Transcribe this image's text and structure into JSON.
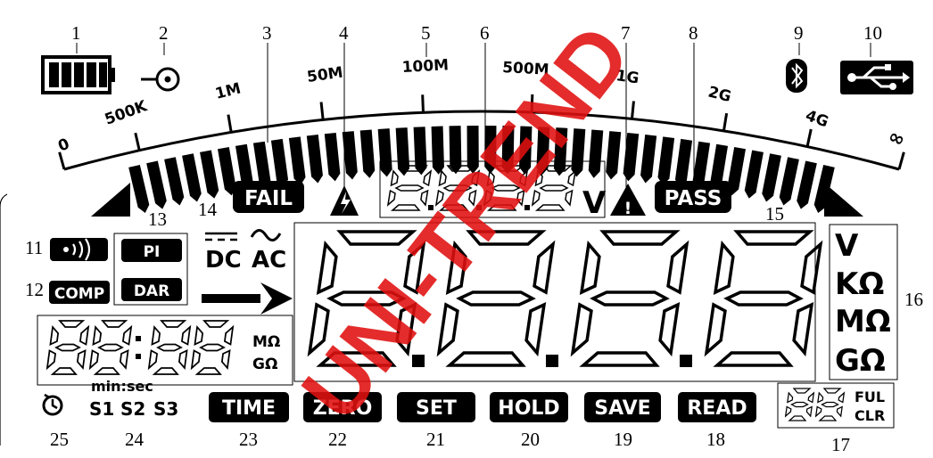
{
  "callouts": [
    "1",
    "2",
    "3",
    "4",
    "5",
    "6",
    "7",
    "8",
    "9",
    "10",
    "11",
    "12",
    "13",
    "14",
    "15",
    "16",
    "17",
    "18",
    "19",
    "20",
    "21",
    "22",
    "23",
    "24",
    "25"
  ],
  "scale": {
    "s0": "0",
    "s500k": "500K",
    "s1m": "1M",
    "s50m": "50M",
    "s100m": "100M",
    "s500m": "500M",
    "s1g": "1G",
    "s2g": "2G",
    "s4g": "4G",
    "sinf": "∞"
  },
  "indicators": {
    "fail": "FAIL",
    "pass": "PASS",
    "volt": "V",
    "pi": "PI",
    "dar": "DAR",
    "comp": "COMP",
    "dc": "DC",
    "ac": "AC",
    "dc_symbol": "⎓",
    "ac_symbol": "~"
  },
  "timer": {
    "min_sec": "min:sec",
    "s1": "S1",
    "s2": "S2",
    "s3": "S3",
    "mohm": "MΩ",
    "gohm": "GΩ"
  },
  "units": {
    "v": "V",
    "kohm": "KΩ",
    "mohm": "MΩ",
    "gohm": "GΩ"
  },
  "memory": {
    "ful": "FUL",
    "clr": "CLR"
  },
  "buttons": {
    "time": "TIME",
    "zero": "ZERO",
    "set": "SET",
    "hold": "HOLD",
    "save": "SAVE",
    "read": "READ"
  },
  "watermark": "UNI-TREND",
  "colors": {
    "ink": "#000000",
    "watermark": "#e11010"
  }
}
